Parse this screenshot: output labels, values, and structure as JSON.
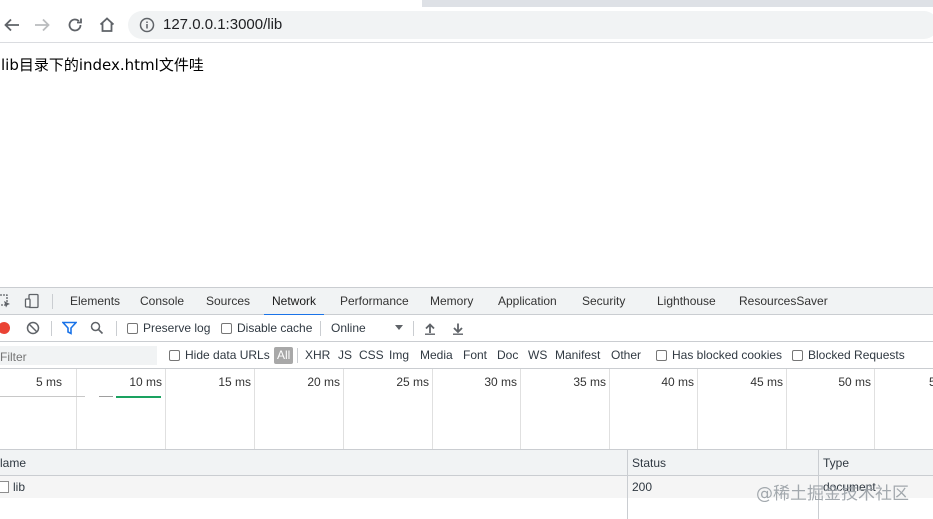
{
  "browser": {
    "url": "127.0.0.1:3000/lib"
  },
  "page": {
    "content_text": "lib目录下的index.html文件哇"
  },
  "devtools": {
    "tabs": [
      "Elements",
      "Console",
      "Sources",
      "Network",
      "Performance",
      "Memory",
      "Application",
      "Security",
      "Lighthouse",
      "ResourcesSaver"
    ],
    "active_tab": "Network",
    "toolbar": {
      "preserve_log": "Preserve log",
      "disable_cache": "Disable cache",
      "throttling": "Online"
    },
    "filter": {
      "placeholder": "Filter",
      "hide_data_urls": "Hide data URLs",
      "types": [
        "All",
        "XHR",
        "JS",
        "CSS",
        "Img",
        "Media",
        "Font",
        "Doc",
        "WS",
        "Manifest",
        "Other"
      ],
      "selected_type": "All",
      "has_blocked_cookies": "Has blocked cookies",
      "blocked_requests": "Blocked Requests"
    },
    "overview": {
      "ticks": [
        "5 ms",
        "10 ms",
        "15 ms",
        "20 ms",
        "25 ms",
        "30 ms",
        "35 ms",
        "40 ms",
        "45 ms",
        "50 ms",
        "5"
      ]
    },
    "table": {
      "columns": [
        "Name",
        "Status",
        "Type"
      ],
      "name_header_visible": "lame",
      "rows": [
        {
          "name": "lib",
          "status": "200",
          "type": "document"
        }
      ]
    }
  },
  "watermark": "@稀土掘金技术社区",
  "colors": {
    "accent": "#1a73e8",
    "record": "#ea4335",
    "filter_active": "#1a73e8",
    "waterfall": "#1aa260"
  }
}
